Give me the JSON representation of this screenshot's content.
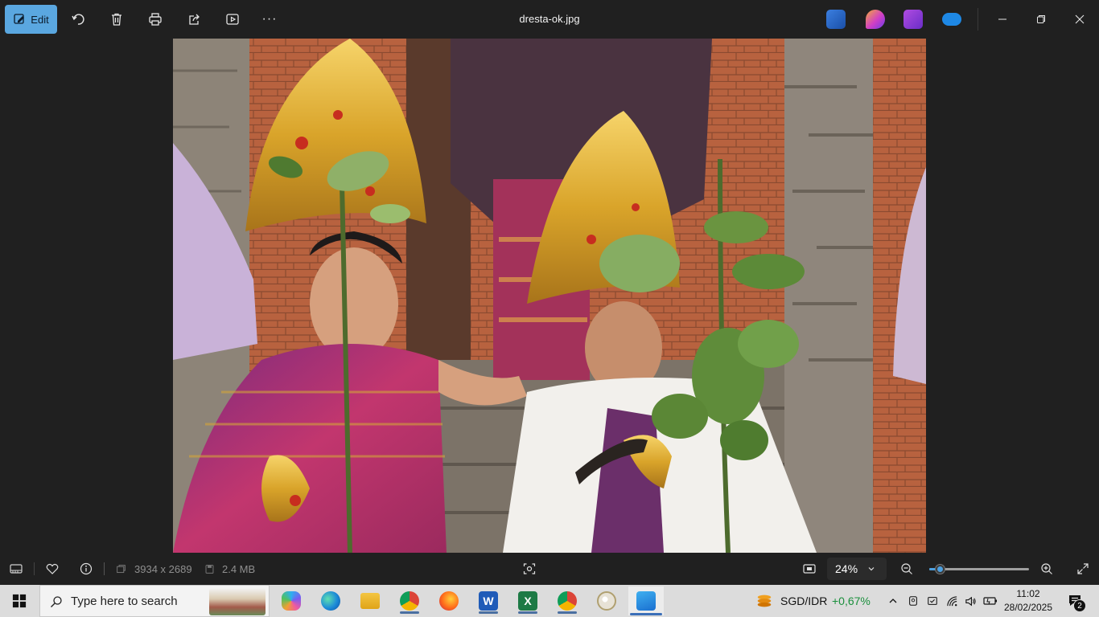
{
  "toolbar": {
    "edit_label": "Edit",
    "file_name": "dresta-ok.jpg",
    "more_label": "···"
  },
  "image_info": {
    "dimensions": "3934 x 2689",
    "size": "2.4 MB"
  },
  "zoom": {
    "value_label": "24%",
    "level_percent": 24
  },
  "taskbar": {
    "search_placeholder": "Type here to search",
    "ticker_pair": "SGD/IDR",
    "ticker_change": "+0,67%",
    "clock_time": "11:02",
    "clock_date": "28/02/2025",
    "notification_count": "2"
  },
  "colors": {
    "accent": "#5aa7e0",
    "positive": "#1a8f3c"
  }
}
